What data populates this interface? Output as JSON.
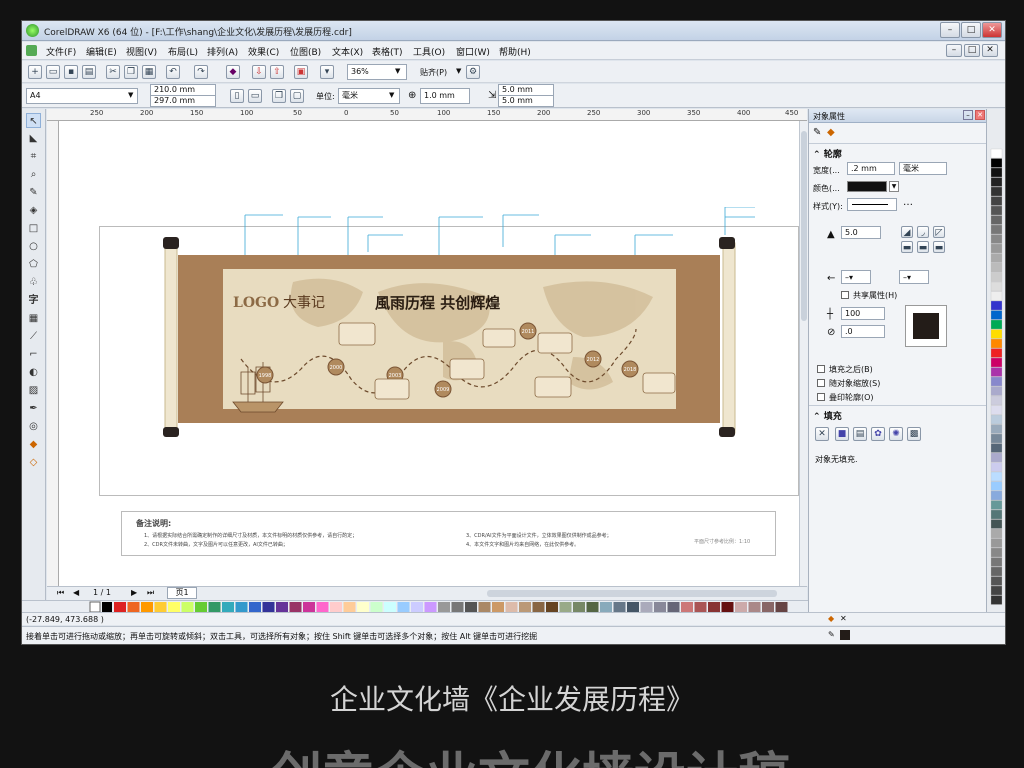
{
  "window": {
    "title": "CorelDRAW X6 (64 位) - [F:\\工作\\shang\\企业文化\\发展历程\\发展历程.cdr]"
  },
  "menu": [
    "文件(F)",
    "编辑(E)",
    "视图(V)",
    "布局(L)",
    "排列(A)",
    "效果(C)",
    "位图(B)",
    "文本(X)",
    "表格(T)",
    "工具(O)",
    "窗口(W)",
    "帮助(H)"
  ],
  "toolbar": {
    "zoom": "36%",
    "snap": "贴齐(P)"
  },
  "propbar": {
    "page_size": "A4",
    "width": "210.0 mm",
    "height": "297.0 mm",
    "unit_label": "单位:",
    "unit": "毫米",
    "nudge": "1.0 mm",
    "dup_x": "5.0 mm",
    "dup_y": "5.0 mm"
  },
  "ruler": {
    "ticks": [
      "250",
      "200",
      "150",
      "100",
      "50",
      "0",
      "50",
      "100",
      "150",
      "200",
      "250",
      "300",
      "350",
      "400",
      "450"
    ]
  },
  "artwork": {
    "logo": "LOGO",
    "headline_left": "大事记",
    "headline": "風雨历程  共创辉煌",
    "years": [
      "1998",
      "2000",
      "2003",
      "2009",
      "2011",
      "2012",
      "2018"
    ],
    "notes_title": "备注说明:",
    "notes": [
      "1、请根据实际结合所需确定制作的详细尺寸及材质，本文件标明的材质仅供参考，请自行酌定；",
      "2、CDR文件未转曲，文字及图片可以任意更改，AI文件已转曲；",
      "3、CDR/AI文件为平面设计文件，立体效果图仅供制作成品参考；",
      "4、本文件文字和图片均来自网络，在此仅供参考。"
    ],
    "scale_note": "平面尺寸参考比例：1:10"
  },
  "pagebar": {
    "counter": "1 / 1",
    "tab": "页1"
  },
  "docker": {
    "title": "对象属性",
    "outline_section": "轮廓",
    "width_label": "宽度(...",
    "width_value": ".2 mm",
    "width_unit": "毫米",
    "color_label": "颜色(...",
    "style_label": "样式(Y):",
    "miter_value": "5.0",
    "share_attr": "共享属性(H)",
    "stretch_value": "100",
    "angle_value": ".0",
    "check_fill_behind": "填充之后(B)",
    "check_scale": "随对象缩放(S)",
    "check_overprint": "叠印轮廓(O)",
    "fill_section": "填充",
    "fill_status": "对象无填充."
  },
  "status": {
    "coords": "(-27.849, 473.688 )",
    "hint": "接着单击可进行拖动或缩放；再单击可旋转或倾斜；双击工具，可选择所有对象；按住 Shift 键单击可选择多个对象；按住 Alt 键单击可进行挖掘"
  },
  "caption": "企业文化墙《企业发展历程》",
  "big_title": "创意企业文化墙设计稿",
  "colors": {
    "scroll_brown": "#a97f57",
    "scroll_inner": "#e8dcc0",
    "window_chrome": "#dfe5ec"
  }
}
